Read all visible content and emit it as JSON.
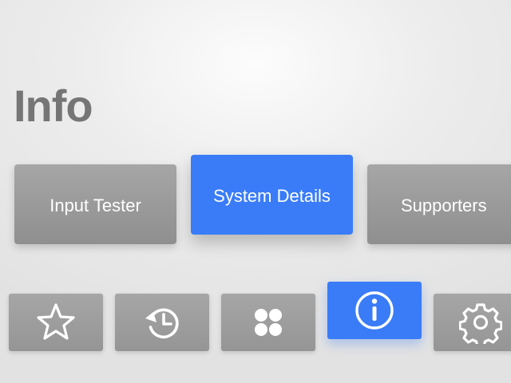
{
  "page": {
    "title": "Info"
  },
  "cards": [
    {
      "label": "Input Tester",
      "active": false
    },
    {
      "label": "System Details",
      "active": true
    },
    {
      "label": "Supporters",
      "active": false
    }
  ],
  "navbar": [
    {
      "icon": "star-icon",
      "active": false
    },
    {
      "icon": "history-icon",
      "active": false
    },
    {
      "icon": "apps-grid-icon",
      "active": false
    },
    {
      "icon": "info-icon",
      "active": true
    },
    {
      "icon": "gear-icon",
      "active": false
    }
  ],
  "colors": {
    "accent": "#3a7cf8",
    "inactive_tile": "#9c9c9c",
    "title_text": "#757575",
    "tile_text": "#ffffff"
  }
}
